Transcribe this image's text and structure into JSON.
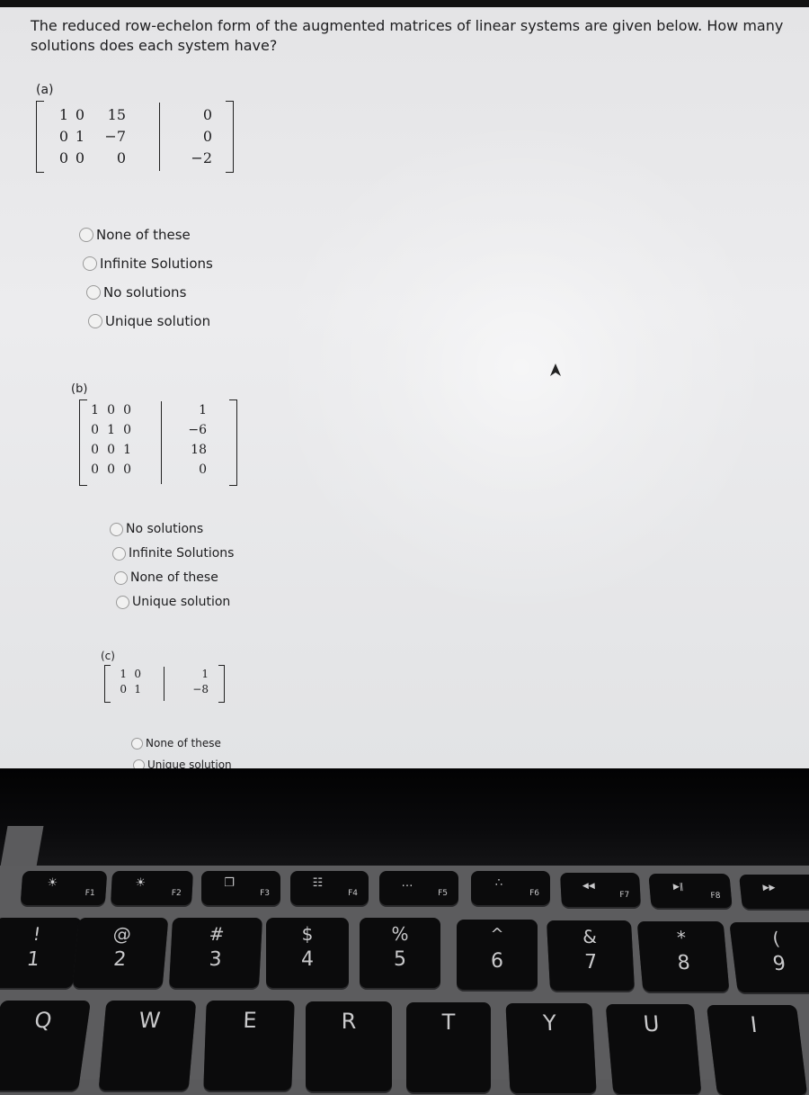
{
  "question": "The reduced row-echelon form of the augmented matrices of linear systems are given below. How many solutions does each system have?",
  "parts": [
    {
      "label": "(a)",
      "matrix": {
        "coefficients": [
          [
            "1",
            "0",
            "15"
          ],
          [
            "0",
            "1",
            "−7"
          ],
          [
            "0",
            "0",
            "0"
          ]
        ],
        "constants": [
          "0",
          "0",
          "−2"
        ]
      },
      "options": [
        "None of these",
        "Infinite Solutions",
        "No solutions",
        "Unique solution"
      ]
    },
    {
      "label": "(b)",
      "matrix": {
        "coefficients": [
          [
            "1",
            "0",
            "0"
          ],
          [
            "0",
            "1",
            "0"
          ],
          [
            "0",
            "0",
            "1"
          ],
          [
            "0",
            "0",
            "0"
          ]
        ],
        "constants": [
          "1",
          "−6",
          "18",
          "0"
        ]
      },
      "options": [
        "No solutions",
        "Infinite Solutions",
        "None of these",
        "Unique solution"
      ]
    },
    {
      "label": "(c)",
      "matrix": {
        "coefficients": [
          [
            "1",
            "0"
          ],
          [
            "0",
            "1"
          ]
        ],
        "constants": [
          "1",
          "−8"
        ]
      },
      "options": [
        "None of these",
        "Unique solution"
      ]
    }
  ],
  "keyboard": {
    "function_row": [
      {
        "label": "F1",
        "icon": "☀"
      },
      {
        "label": "F2",
        "icon": "☀"
      },
      {
        "label": "F3",
        "icon": "❐"
      },
      {
        "label": "F4",
        "icon": "☷"
      },
      {
        "label": "F5",
        "icon": "…"
      },
      {
        "label": "F6",
        "icon": "∴"
      },
      {
        "label": "F7",
        "icon": "◀◀"
      },
      {
        "label": "F8",
        "icon": "▶‖"
      },
      {
        "label": "",
        "icon": "▶▶"
      }
    ],
    "number_row": [
      {
        "shift": "!",
        "main": "1"
      },
      {
        "shift": "@",
        "main": "2"
      },
      {
        "shift": "#",
        "main": "3"
      },
      {
        "shift": "$",
        "main": "4"
      },
      {
        "shift": "%",
        "main": "5"
      },
      {
        "shift": "^",
        "main": "6"
      },
      {
        "shift": "&",
        "main": "7"
      },
      {
        "shift": "*",
        "main": "8"
      },
      {
        "shift": "(",
        "main": "9"
      }
    ],
    "letter_row": [
      "Q",
      "W",
      "E",
      "R",
      "T",
      "Y",
      "U",
      "I"
    ]
  }
}
